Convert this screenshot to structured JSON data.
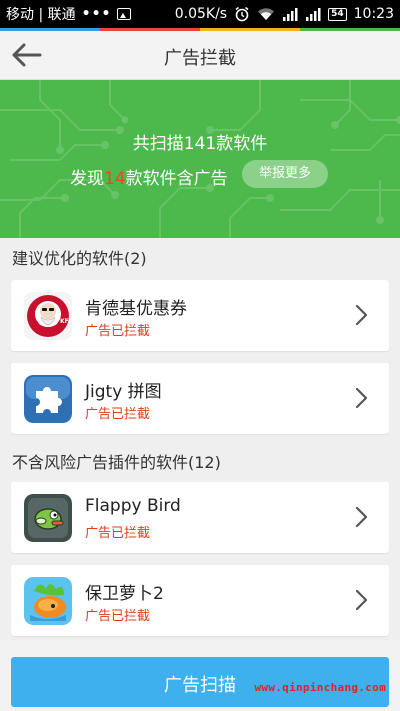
{
  "status_bar": {
    "carrier": "移动 | 联通",
    "dots": "•••",
    "speed": "0.05K/s",
    "battery": "54",
    "time": "10:23"
  },
  "header": {
    "title": "广告拦截"
  },
  "banner": {
    "summary": "共扫描141款软件",
    "found_prefix": "发现",
    "found_count": "14",
    "found_suffix": "款软件含广告",
    "report_label": "举报更多"
  },
  "sections": [
    {
      "title": "建议优化的软件(2)"
    },
    {
      "title": "不含风险广告插件的软件(12)"
    }
  ],
  "apps": [
    {
      "name": "肯德基优惠券",
      "status": "广告已拦截",
      "icon": "kfc-icon"
    },
    {
      "name": "Jigty 拼图",
      "status": "广告已拦截",
      "icon": "puzzle-icon"
    },
    {
      "name": "Flappy Bird",
      "status": "广告已拦截",
      "icon": "flappy-bird-icon"
    },
    {
      "name": "保卫萝卜2",
      "status": "广告已拦截",
      "icon": "carrot-icon"
    }
  ],
  "bottom": {
    "scan_label": "广告扫描",
    "watermark": "www.qinpinchang.com"
  },
  "colors": {
    "banner_green": "#4db84c",
    "highlight_red": "#e84a1f",
    "status_red": "#e33b1e",
    "button_blue": "#3fb0ee"
  }
}
